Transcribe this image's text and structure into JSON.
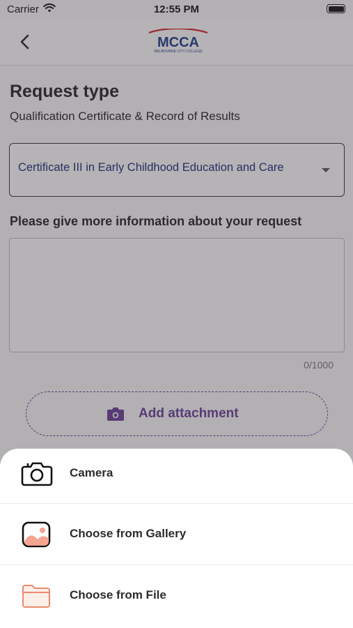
{
  "status_bar": {
    "carrier": "Carrier",
    "time": "12:55 PM"
  },
  "header": {
    "logo_text": "MCCA",
    "logo_sub": "MELBOURNE CITY COLLEGE"
  },
  "form": {
    "title": "Request type",
    "subtitle": "Qualification Certificate & Record of Results",
    "select_value": "Certificate III in Early Childhood Education and Care",
    "info_label": "Please give more information about your request",
    "textarea_value": "",
    "char_count": "0/1000",
    "attach_label": "Add attachment"
  },
  "sheet": {
    "items": [
      {
        "label": "Camera",
        "icon": "camera-icon"
      },
      {
        "label": "Choose from Gallery",
        "icon": "gallery-icon"
      },
      {
        "label": "Choose from File",
        "icon": "folder-icon"
      }
    ]
  },
  "colors": {
    "accent": "#6a3d9a",
    "select_text": "#1d2a7a",
    "logo_red": "#d6202a",
    "logo_blue": "#1f3a8a"
  }
}
